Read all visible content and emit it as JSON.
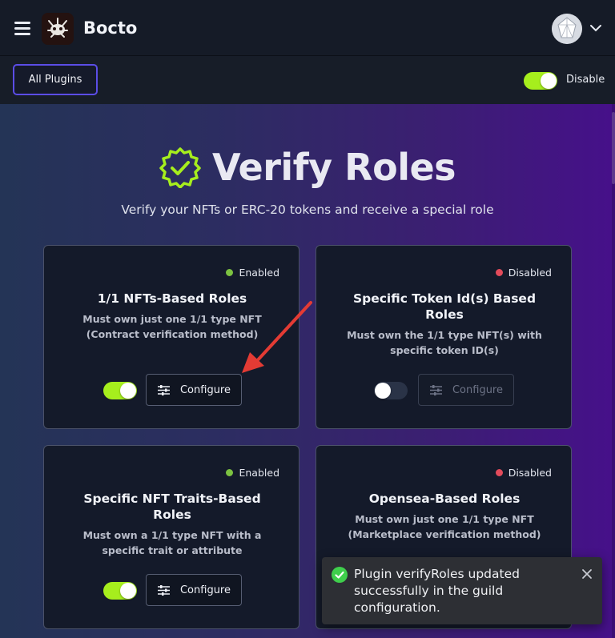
{
  "header": {
    "brand": "Bocto",
    "menu_icon": "hamburger-menu-icon",
    "logo_icon": "bocto-logo-icon",
    "avatar_icon": "user-avatar",
    "chevron_icon": "chevron-down-icon"
  },
  "subbar": {
    "all_plugins_label": "All Plugins",
    "toggle_state": "on",
    "toggle_label": "Disable"
  },
  "hero": {
    "title": "Verify Roles",
    "subtitle": "Verify your NFTs or ERC-20 tokens and receive a special role",
    "icon": "verified-badge-icon"
  },
  "cards": [
    {
      "status": "Enabled",
      "status_color": "#7cc241",
      "title": "1/1 NFTs-Based Roles",
      "description": "Must own just one 1/1 type NFT (Contract verification method)",
      "toggle": "on",
      "configure_label": "Configure",
      "configure_enabled": true
    },
    {
      "status": "Disabled",
      "status_color": "#e34b5b",
      "title": "Specific Token Id(s) Based Roles",
      "description": "Must own the 1/1 type NFT(s) with specific token ID(s)",
      "toggle": "off",
      "configure_label": "Configure",
      "configure_enabled": false
    },
    {
      "status": "Enabled",
      "status_color": "#7cc241",
      "title": "Specific NFT Traits-Based Roles",
      "description": "Must own a 1/1 type NFT with a specific trait or attribute",
      "toggle": "on",
      "configure_label": "Configure",
      "configure_enabled": true
    },
    {
      "status": "Disabled",
      "status_color": "#e34b5b",
      "title": "Opensea-Based Roles",
      "description": "Must own just one 1/1 type NFT (Marketplace verification method)"
    }
  ],
  "toast": {
    "message": "Plugin verifyRoles updated successfully in the guild configuration.",
    "icon": "success-check-icon",
    "close_icon": "close-icon"
  },
  "colors": {
    "accent_green": "#a6ee1d",
    "border_purple": "#5b4de6",
    "success_green": "#3fcf4c",
    "annotation_arrow": "#e33b34"
  }
}
